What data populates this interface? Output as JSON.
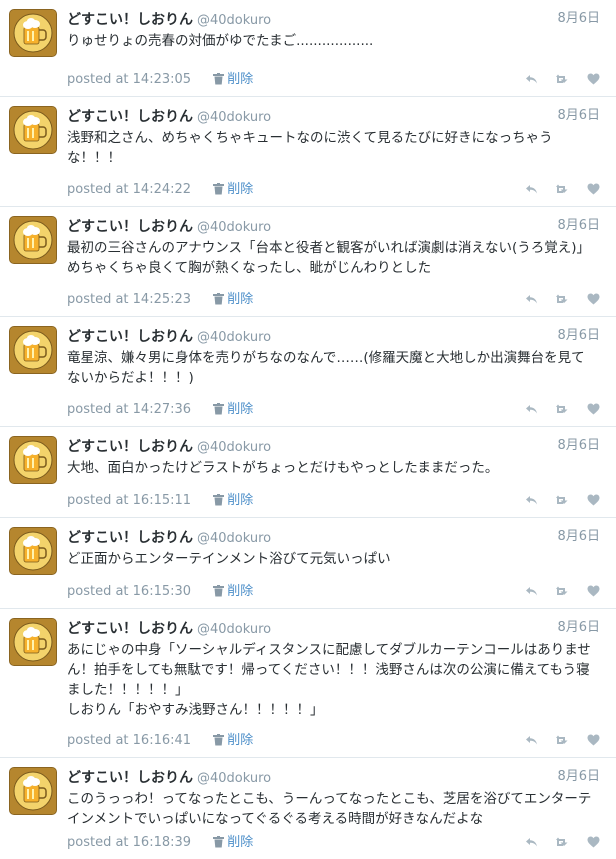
{
  "colors": {
    "accent": "#4d8fc9",
    "muted": "#8899a6",
    "text": "#292f33",
    "avatar_bg": "#b5862e"
  },
  "icons": {
    "delete": "trash-icon",
    "reply": "reply-icon",
    "retweet": "retweet-icon",
    "like": "heart-icon"
  },
  "tweets": [
    {
      "name": "どすこい！しおりん",
      "handle": "@40dokuro",
      "date": "8月6日",
      "text": "りゅせりょの売春の対価がゆでたまご..................",
      "posted": "posted at 14:23:05",
      "delete_label": "削除"
    },
    {
      "name": "どすこい！しおりん",
      "handle": "@40dokuro",
      "date": "8月6日",
      "text": "浅野和之さん、めちゃくちゃキュートなのに渋くて見るたびに好きになっちゃうな！！！",
      "posted": "posted at 14:24:22",
      "delete_label": "削除"
    },
    {
      "name": "どすこい！しおりん",
      "handle": "@40dokuro",
      "date": "8月6日",
      "text": "最初の三谷さんのアナウンス「台本と役者と観客がいれば演劇は消えない(うろ覚え)」めちゃくちゃ良くて胸が熱くなったし、眦がじんわりとした",
      "posted": "posted at 14:25:23",
      "delete_label": "削除"
    },
    {
      "name": "どすこい！しおりん",
      "handle": "@40dokuro",
      "date": "8月6日",
      "text": "竜星涼、嫌々男に身体を売りがちなのなんで……(修羅天魔と大地しか出演舞台を見てないからだよ！！！)",
      "posted": "posted at 14:27:36",
      "delete_label": "削除"
    },
    {
      "name": "どすこい！しおりん",
      "handle": "@40dokuro",
      "date": "8月6日",
      "text": "大地、面白かったけどラストがちょっとだけもやっとしたままだった。",
      "posted": "posted at 16:15:11",
      "delete_label": "削除"
    },
    {
      "name": "どすこい！しおりん",
      "handle": "@40dokuro",
      "date": "8月6日",
      "text": "ど正面からエンターテインメント浴びて元気いっぱい",
      "posted": "posted at 16:15:30",
      "delete_label": "削除"
    },
    {
      "name": "どすこい！しおりん",
      "handle": "@40dokuro",
      "date": "8月6日",
      "text": "あにじゃの中身「ソーシャルディスタンスに配慮してダブルカーテンコールはありません！拍手をしても無駄です！帰ってください！！！浅野さんは次の公演に備えてもう寝ました！！！！！」\nしおりん「おやすみ浅野さん！！！！！」",
      "posted": "posted at 16:16:41",
      "delete_label": "削除"
    },
    {
      "name": "どすこい！しおりん",
      "handle": "@40dokuro",
      "date": "8月6日",
      "text": "このうっっわ！ってなったとこも、うーんってなったとこも、芝居を浴びてエンターテインメントでいっぱいになってぐるぐる考える時間が好きなんだよな",
      "posted": "posted at 16:18:39",
      "delete_label": "削除"
    }
  ]
}
